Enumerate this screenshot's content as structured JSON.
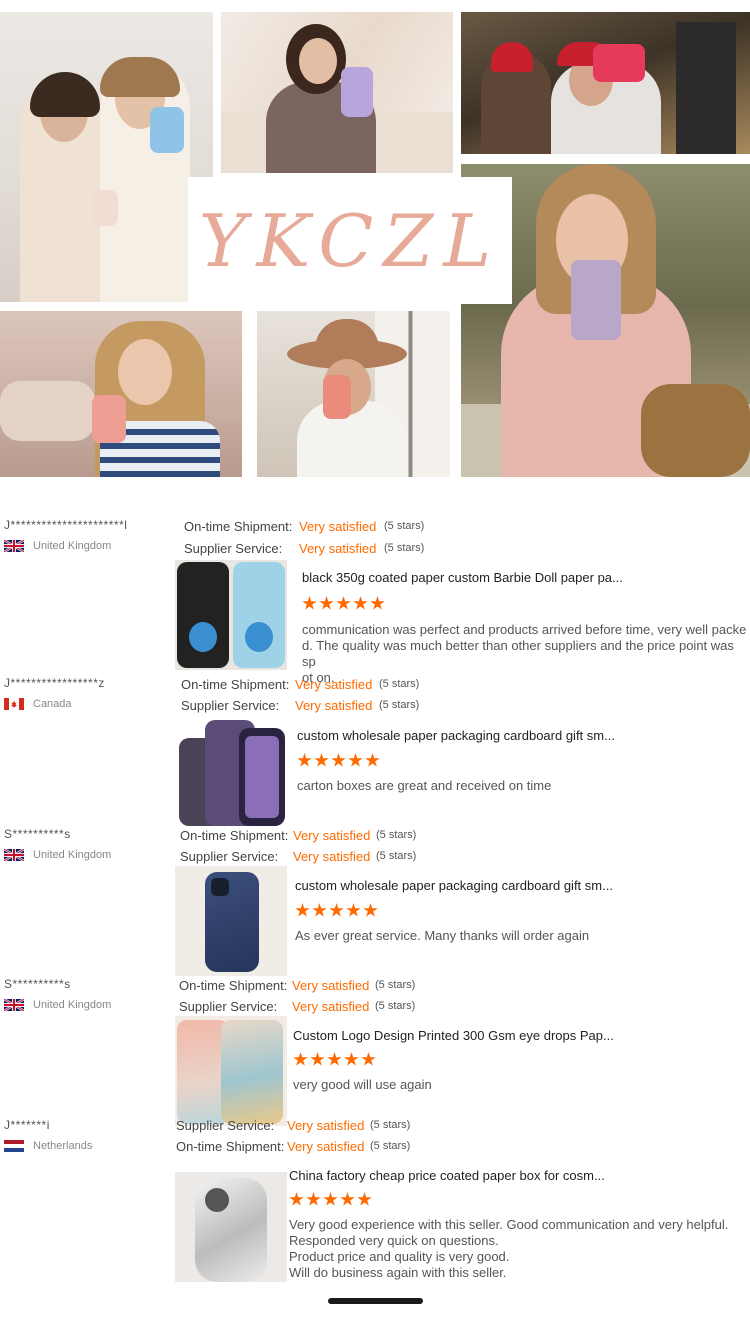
{
  "brand": {
    "logo_text": "YKCZL"
  },
  "reviews": [
    {
      "buyer": "J**********************l",
      "country": "United Kingdom",
      "flag": "uk-flag",
      "ratings": [
        {
          "label": "On-time Shipment:",
          "value": "Very satisfied",
          "count": "(5 stars)"
        },
        {
          "label": "Supplier Service:",
          "value": "Very satisfied",
          "count": "(5 stars)"
        }
      ],
      "product_title": "black 350g coated paper custom Barbie Doll paper pa...",
      "stars": 5,
      "comment": [
        "communication was perfect and products arrived before time, very well packe",
        "d. The quality was much better than other suppliers and the price point was sp",
        "ot on."
      ]
    },
    {
      "buyer": "J*****************z",
      "country": "Canada",
      "flag": "canada-flag",
      "ratings": [
        {
          "label": "On-time Shipment:",
          "value": "Very satisfied",
          "count": "(5 stars)"
        },
        {
          "label": "Supplier Service:",
          "value": "Very satisfied",
          "count": "(5 stars)"
        }
      ],
      "product_title": "custom wholesale paper packaging cardboard gift sm...",
      "stars": 5,
      "comment": [
        "carton boxes are great and received on time"
      ]
    },
    {
      "buyer": "S**********s",
      "country": "United Kingdom",
      "flag": "uk-flag",
      "ratings": [
        {
          "label": "On-time Shipment:",
          "value": "Very satisfied",
          "count": "(5 stars)"
        },
        {
          "label": "Supplier Service:",
          "value": "Very satisfied",
          "count": "(5 stars)"
        }
      ],
      "product_title": "custom wholesale paper packaging cardboard gift sm...",
      "stars": 5,
      "comment": [
        "As ever great service. Many thanks will order again"
      ]
    },
    {
      "buyer": "S**********s",
      "country": "United Kingdom",
      "flag": "uk-flag",
      "ratings": [
        {
          "label": "On-time Shipment:",
          "value": "Very satisfied",
          "count": "(5 stars)"
        },
        {
          "label": "Supplier Service:",
          "value": "Very satisfied",
          "count": "(5 stars)"
        }
      ],
      "product_title": "Custom Logo Design Printed 300 Gsm eye drops Pap...",
      "stars": 5,
      "comment": [
        "very good will use again"
      ]
    },
    {
      "buyer": "J*******i",
      "country": "Netherlands",
      "flag": "netherlands-flag",
      "ratings": [
        {
          "label": "Supplier Service:",
          "value": "Very satisfied",
          "count": "(5 stars)"
        },
        {
          "label": "On-time Shipment:",
          "value": "Very satisfied",
          "count": "(5 stars)"
        }
      ],
      "product_title": "China factory cheap price coated paper box for cosm...",
      "stars": 5,
      "comment": [
        "Very good experience with this seller. Good communication and very helpful.",
        "Responded very quick on questions.",
        "Product price and quality is very good.",
        "Will do business again with this seller."
      ]
    }
  ]
}
